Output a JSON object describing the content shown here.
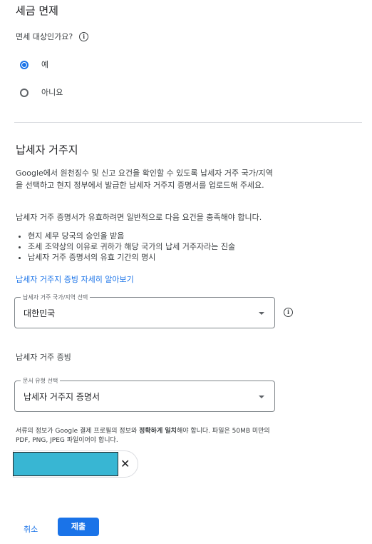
{
  "exemption": {
    "title": "세금 면제",
    "question": "면세 대상인가요?",
    "options": [
      {
        "label": "예",
        "selected": true
      },
      {
        "label": "아니요",
        "selected": false
      }
    ]
  },
  "residency": {
    "title": "납세자 거주지",
    "description": "Google에서 원천징수 및 신고 요건을 확인할 수 있도록 납세자 거주 국가/지역을 선택하고 현지 정부에서 발급한 납세자 거주지 증명서를 업로드해 주세요.",
    "requirements_intro": "납세자 거주 증명서가 유효하려면 일반적으로 다음 요건을 충족해야 합니다.",
    "requirements": [
      "현지 세무 당국의 승인을 받음",
      "조세 조약상의 이유로 귀하가 해당 국가의 납세 거주자라는 진술",
      "납세자 거주 증명서의 유효 기간의 명시"
    ],
    "learn_more_link": "납세자 거주지 증빙 자세히 알아보기",
    "country_select": {
      "label": "납세자 거주 국가/지역 선택",
      "value": "대한민국"
    },
    "proof_title": "납세자 거주 증빙",
    "document_select": {
      "label": "문서 유형 선택",
      "value": "납세자 거주지 증명서"
    },
    "file_note_part1": "서류의 정보가 Google 결제 프로필의 정보와 ",
    "file_note_bold": "정확하게 일치",
    "file_note_part2": "해야 합니다. 파일은 50MB 미만의 PDF, PNG, JPEG 파일이어야 합니다.",
    "file_chip": {
      "remove_label": "✕"
    }
  },
  "footer": {
    "cancel_label": "취소",
    "submit_label": "제출"
  },
  "colors": {
    "accent": "#1a73e8",
    "redacted": "#38b6d3"
  }
}
